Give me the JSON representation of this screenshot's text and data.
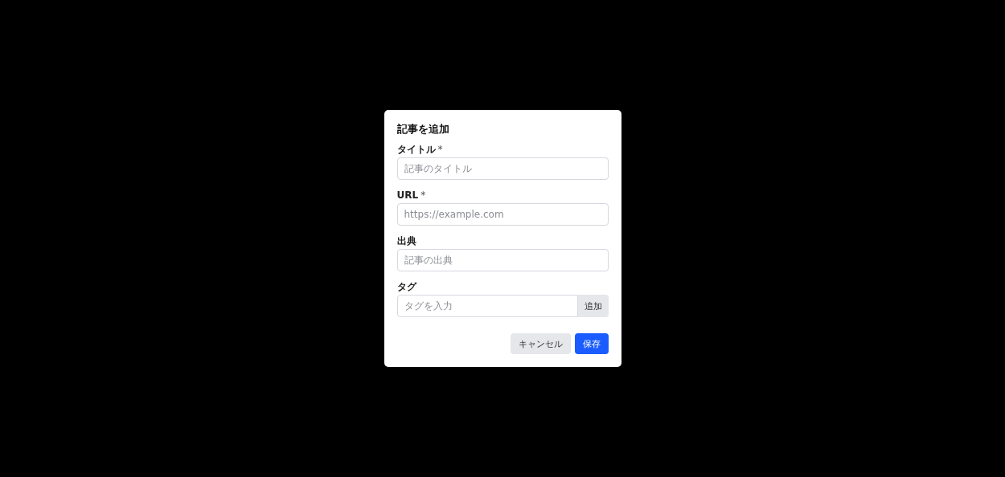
{
  "dialog": {
    "title": "記事を追加",
    "fields": [
      {
        "kind": "text",
        "label": "タイトル",
        "required_mark": "*",
        "placeholder": "記事のタイトル"
      },
      {
        "kind": "text",
        "label": "URL",
        "required_mark": "*",
        "placeholder": "https://example.com"
      },
      {
        "kind": "text",
        "label": "出典",
        "placeholder": "記事の出典"
      },
      {
        "kind": "tag",
        "label": "タグ",
        "placeholder": "タグを入力",
        "button": "追加"
      }
    ],
    "buttons": [
      {
        "kind": "secondary",
        "label": "キャンセル"
      },
      {
        "kind": "primary",
        "label": "保存"
      }
    ]
  }
}
